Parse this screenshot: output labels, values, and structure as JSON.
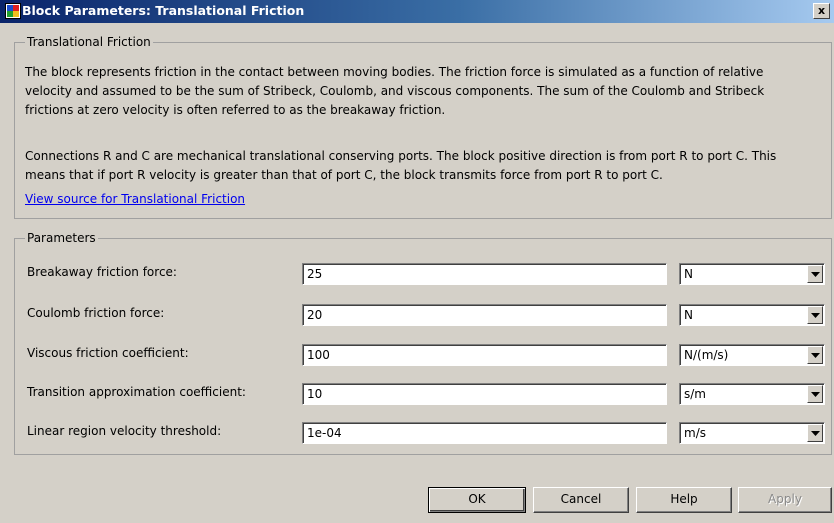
{
  "window": {
    "title": "Block Parameters: Translational Friction",
    "close_label": "x"
  },
  "description_group": {
    "legend": "Translational Friction",
    "paragraph1_lines": [
      "The block represents friction in the contact between moving bodies. The friction force is simulated as a function of relative",
      "velocity and assumed to be the sum of Stribeck, Coulomb, and viscous components. The sum of the Coulomb and Stribeck",
      "frictions at zero velocity is often referred to as the breakaway friction."
    ],
    "paragraph2_lines": [
      "Connections R and C are mechanical translational conserving ports. The block positive direction is from port R to port C. This",
      "means that if port R velocity is greater than that of port C, the block transmits force from port R to port C."
    ],
    "source_link": "View source for Translational Friction"
  },
  "parameters_group": {
    "legend": "Parameters",
    "rows": [
      {
        "label": "Breakaway friction force:",
        "value": "25",
        "unit": "N"
      },
      {
        "label": "Coulomb friction force:",
        "value": "20",
        "unit": "N"
      },
      {
        "label": "Viscous friction coefficient:",
        "value": "100",
        "unit": "N/(m/s)"
      },
      {
        "label": "Transition approximation coefficient:",
        "value": "10",
        "unit": "s/m"
      },
      {
        "label": "Linear region velocity threshold:",
        "value": "1e-04",
        "unit": "m/s"
      }
    ]
  },
  "buttons": {
    "ok": "OK",
    "cancel": "Cancel",
    "help": "Help",
    "apply": "Apply"
  },
  "icons": {
    "title_icon": "simulink-block-icon",
    "dropdown_icon": "chevron-down-icon"
  },
  "colors": {
    "titlebar_start": "#0a246a",
    "titlebar_end": "#a6caf0",
    "dialog_bg": "#d4d0c8",
    "link": "#0000ee"
  }
}
